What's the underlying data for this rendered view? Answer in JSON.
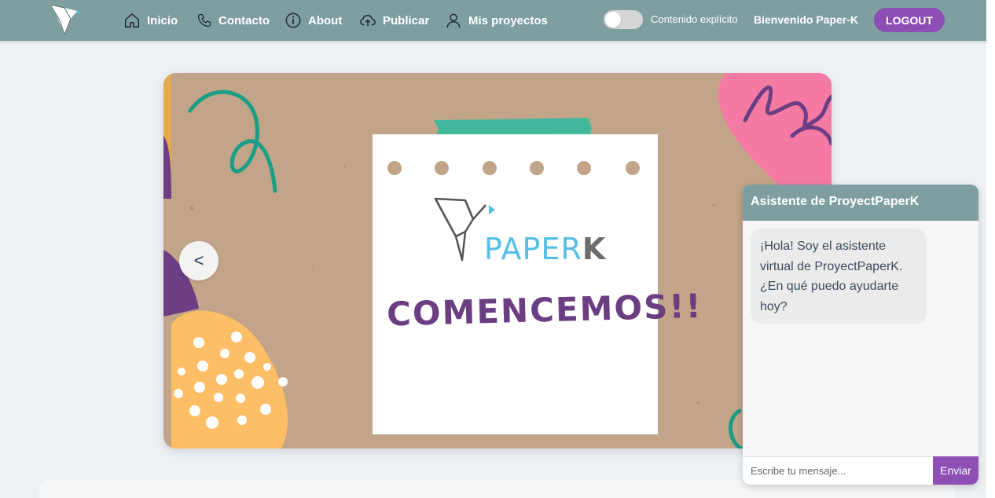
{
  "navbar": {
    "items": [
      {
        "label": "Inicio",
        "icon": "home-icon"
      },
      {
        "label": "Contacto",
        "icon": "phone-icon"
      },
      {
        "label": "About",
        "icon": "info-icon"
      },
      {
        "label": "Publicar",
        "icon": "cloud-upload-icon"
      },
      {
        "label": "Mis proyectos",
        "icon": "user-icon"
      }
    ],
    "toggle_label": "Contenido explícito",
    "toggle_on": false,
    "welcome": "Bienvenido Paper-K",
    "logout_label": "LOGOUT"
  },
  "carousel": {
    "brand_light": "PAPER",
    "brand_dark": "K",
    "headline": "COMENCEMOS!!",
    "prev_label": "<"
  },
  "chat": {
    "title": "Asistente de ProyectPaperK",
    "messages": [
      {
        "from": "bot",
        "text": "¡Hola! Soy el asistente virtual de ProyectPaperK. ¿En qué puedo ayudarte hoy?"
      }
    ],
    "input_placeholder": "Escribe tu mensaje...",
    "send_label": "Enviar"
  },
  "colors": {
    "navbar": "#7e9ea0",
    "accent": "#8e4fb4",
    "headline": "#6b3d82",
    "brand_blue": "#56bfe8"
  }
}
